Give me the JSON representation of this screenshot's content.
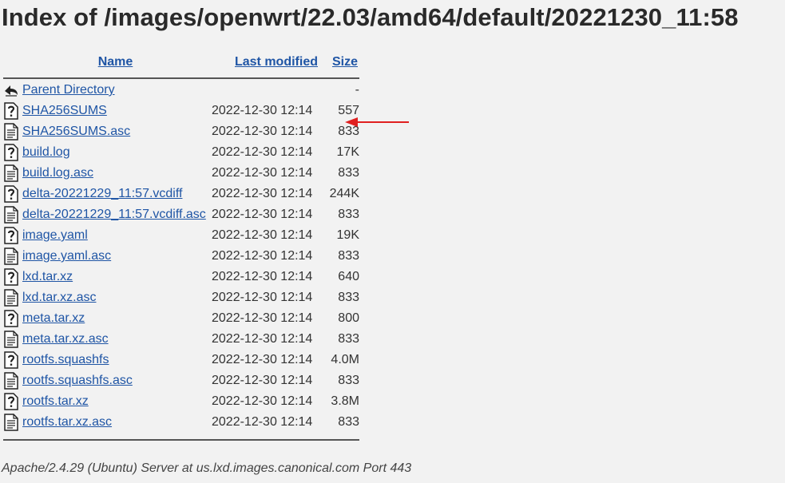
{
  "page": {
    "title": "Index of /images/openwrt/22.03/amd64/default/20221230_11:58",
    "footer": "Apache/2.4.29 (Ubuntu) Server at us.lxd.images.canonical.com Port 443"
  },
  "table": {
    "headers": {
      "name": "Name",
      "modified": "Last modified",
      "size": "Size"
    },
    "parent": {
      "name": "Parent Directory",
      "size": "-"
    },
    "rows": [
      {
        "name": "SHA256SUMS",
        "modified": "2022-12-30 12:14",
        "size": "557",
        "icon": "unknown-file-icon"
      },
      {
        "name": "SHA256SUMS.asc",
        "modified": "2022-12-30 12:14",
        "size": "833",
        "icon": "text-file-icon"
      },
      {
        "name": "build.log",
        "modified": "2022-12-30 12:14",
        "size": "17K",
        "icon": "unknown-file-icon"
      },
      {
        "name": "build.log.asc",
        "modified": "2022-12-30 12:14",
        "size": "833",
        "icon": "text-file-icon"
      },
      {
        "name": "delta-20221229_11:57.vcdiff",
        "modified": "2022-12-30 12:14",
        "size": "244K",
        "icon": "unknown-file-icon"
      },
      {
        "name": "delta-20221229_11:57.vcdiff.asc",
        "modified": "2022-12-30 12:14",
        "size": "833",
        "icon": "text-file-icon"
      },
      {
        "name": "image.yaml",
        "modified": "2022-12-30 12:14",
        "size": "19K",
        "icon": "unknown-file-icon"
      },
      {
        "name": "image.yaml.asc",
        "modified": "2022-12-30 12:14",
        "size": "833",
        "icon": "text-file-icon"
      },
      {
        "name": "lxd.tar.xz",
        "modified": "2022-12-30 12:14",
        "size": "640",
        "icon": "unknown-file-icon"
      },
      {
        "name": "lxd.tar.xz.asc",
        "modified": "2022-12-30 12:14",
        "size": "833",
        "icon": "text-file-icon"
      },
      {
        "name": "meta.tar.xz",
        "modified": "2022-12-30 12:14",
        "size": "800",
        "icon": "unknown-file-icon"
      },
      {
        "name": "meta.tar.xz.asc",
        "modified": "2022-12-30 12:14",
        "size": "833",
        "icon": "text-file-icon"
      },
      {
        "name": "rootfs.squashfs",
        "modified": "2022-12-30 12:14",
        "size": "4.0M",
        "icon": "unknown-file-icon"
      },
      {
        "name": "rootfs.squashfs.asc",
        "modified": "2022-12-30 12:14",
        "size": "833",
        "icon": "text-file-icon"
      },
      {
        "name": "rootfs.tar.xz",
        "modified": "2022-12-30 12:14",
        "size": "3.8M",
        "icon": "unknown-file-icon"
      },
      {
        "name": "rootfs.tar.xz.asc",
        "modified": "2022-12-30 12:14",
        "size": "833",
        "icon": "text-file-icon"
      }
    ]
  },
  "annotation": {
    "arrow_color": "#e02020",
    "points_to": "SHA256SUMS size 557"
  },
  "colors": {
    "link": "#1f55a5",
    "background": "#f2f2f2"
  }
}
